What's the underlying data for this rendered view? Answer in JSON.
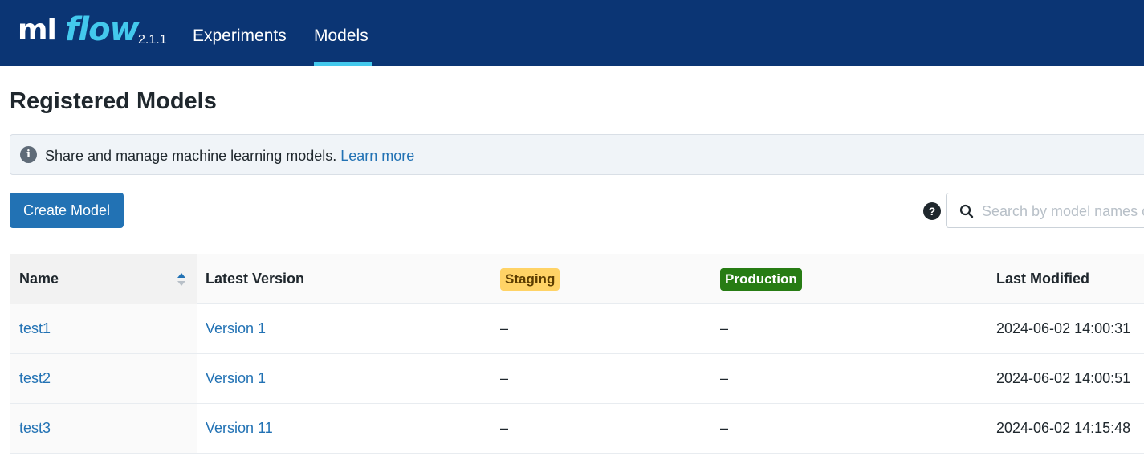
{
  "header": {
    "logo_ml": "ml",
    "logo_flow": "flow",
    "version": "2.1.1",
    "nav": [
      {
        "label": "Experiments",
        "active": false
      },
      {
        "label": "Models",
        "active": true
      }
    ],
    "background_color": "#0b3574",
    "accent_color": "#43c9ed"
  },
  "page": {
    "title": "Registered Models",
    "info": {
      "icon": "info-icon",
      "text": "Share and manage machine learning models.",
      "link_text": "Learn more"
    },
    "create_button_label": "Create Model",
    "search": {
      "help_icon": "question-circle-icon",
      "icon": "search-icon",
      "value": "",
      "placeholder": "Search by model names or tags"
    }
  },
  "table": {
    "headers": {
      "name": "Name",
      "latest_version": "Latest Version",
      "staging": "Staging",
      "production": "Production",
      "last_modified": "Last Modified"
    },
    "sort_icon": "sort-icon",
    "rows": [
      {
        "name": "test1",
        "latest_version": "Version 1",
        "staging": "–",
        "production": "–",
        "last_modified": "2024-06-02 14:00:31"
      },
      {
        "name": "test2",
        "latest_version": "Version 1",
        "staging": "–",
        "production": "–",
        "last_modified": "2024-06-02 14:00:51"
      },
      {
        "name": "test3",
        "latest_version": "Version 11",
        "staging": "–",
        "production": "–",
        "last_modified": "2024-06-02 14:15:48"
      }
    ]
  },
  "colors": {
    "primary": "#2272b4",
    "staging_tag": "#ffd366",
    "production_tag": "#277c14"
  }
}
